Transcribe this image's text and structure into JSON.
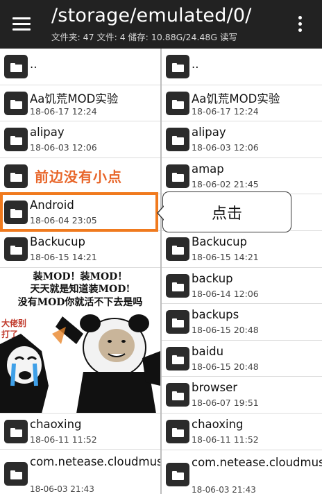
{
  "header": {
    "path": "/storage/emulated/0/",
    "stats": "文件夹: 47  文件: 4  储存: 10.88G/24.48G  读写"
  },
  "left_pane": {
    "rows_top": [
      {
        "name": "..",
        "date": ""
      },
      {
        "name": "Aa饥荒MOD实验",
        "date": "18-06-17 12:24"
      },
      {
        "name": "alipay",
        "date": "18-06-03 12:06"
      },
      {
        "name": "",
        "date": ""
      },
      {
        "name": "Android",
        "date": "18-06-04 23:05"
      },
      {
        "name": "Backucup",
        "date": "18-06-15 14:21"
      }
    ],
    "meme_caption": [
      "装MOD！装MOD！",
      "天天就是知道装MOD!",
      "没有MOD你就活不下去是吗"
    ],
    "meme_side_text": "大佬别打了",
    "rows_bottom": [
      {
        "name": "chaoxing",
        "date": "18-06-11 11:52"
      },
      {
        "name": "com.netease.cloudmusic",
        "date": "18-06-03 21:43"
      }
    ]
  },
  "right_pane": {
    "rows": [
      {
        "name": "..",
        "date": ""
      },
      {
        "name": "Aa饥荒MOD实验",
        "date": "18-06-17 12:24"
      },
      {
        "name": "alipay",
        "date": "18-06-03 12:06"
      },
      {
        "name": "amap",
        "date": "18-06-02 21:45"
      },
      {
        "name": "",
        "date": ""
      },
      {
        "name": "Backucup",
        "date": "18-06-15 14:21"
      },
      {
        "name": "backup",
        "date": "18-06-14 12:06"
      },
      {
        "name": "backups",
        "date": "18-06-15 20:48"
      },
      {
        "name": "baidu",
        "date": "18-06-15 20:48"
      },
      {
        "name": "browser",
        "date": "18-06-07 19:51"
      },
      {
        "name": "chaoxing",
        "date": "18-06-11 11:52"
      },
      {
        "name": "com.netease.cloudmusic",
        "date": "18-06-03 21:43"
      }
    ]
  },
  "annotations": {
    "note_left": "前边没有小点",
    "callout": "点击"
  },
  "icons": {
    "menu": "hamburger-menu-icon",
    "more": "more-vert-icon",
    "folder": "folder-icon"
  },
  "colors": {
    "toolbar": "#222222",
    "highlight": "#f07a1e",
    "note_text": "#e8662a"
  }
}
